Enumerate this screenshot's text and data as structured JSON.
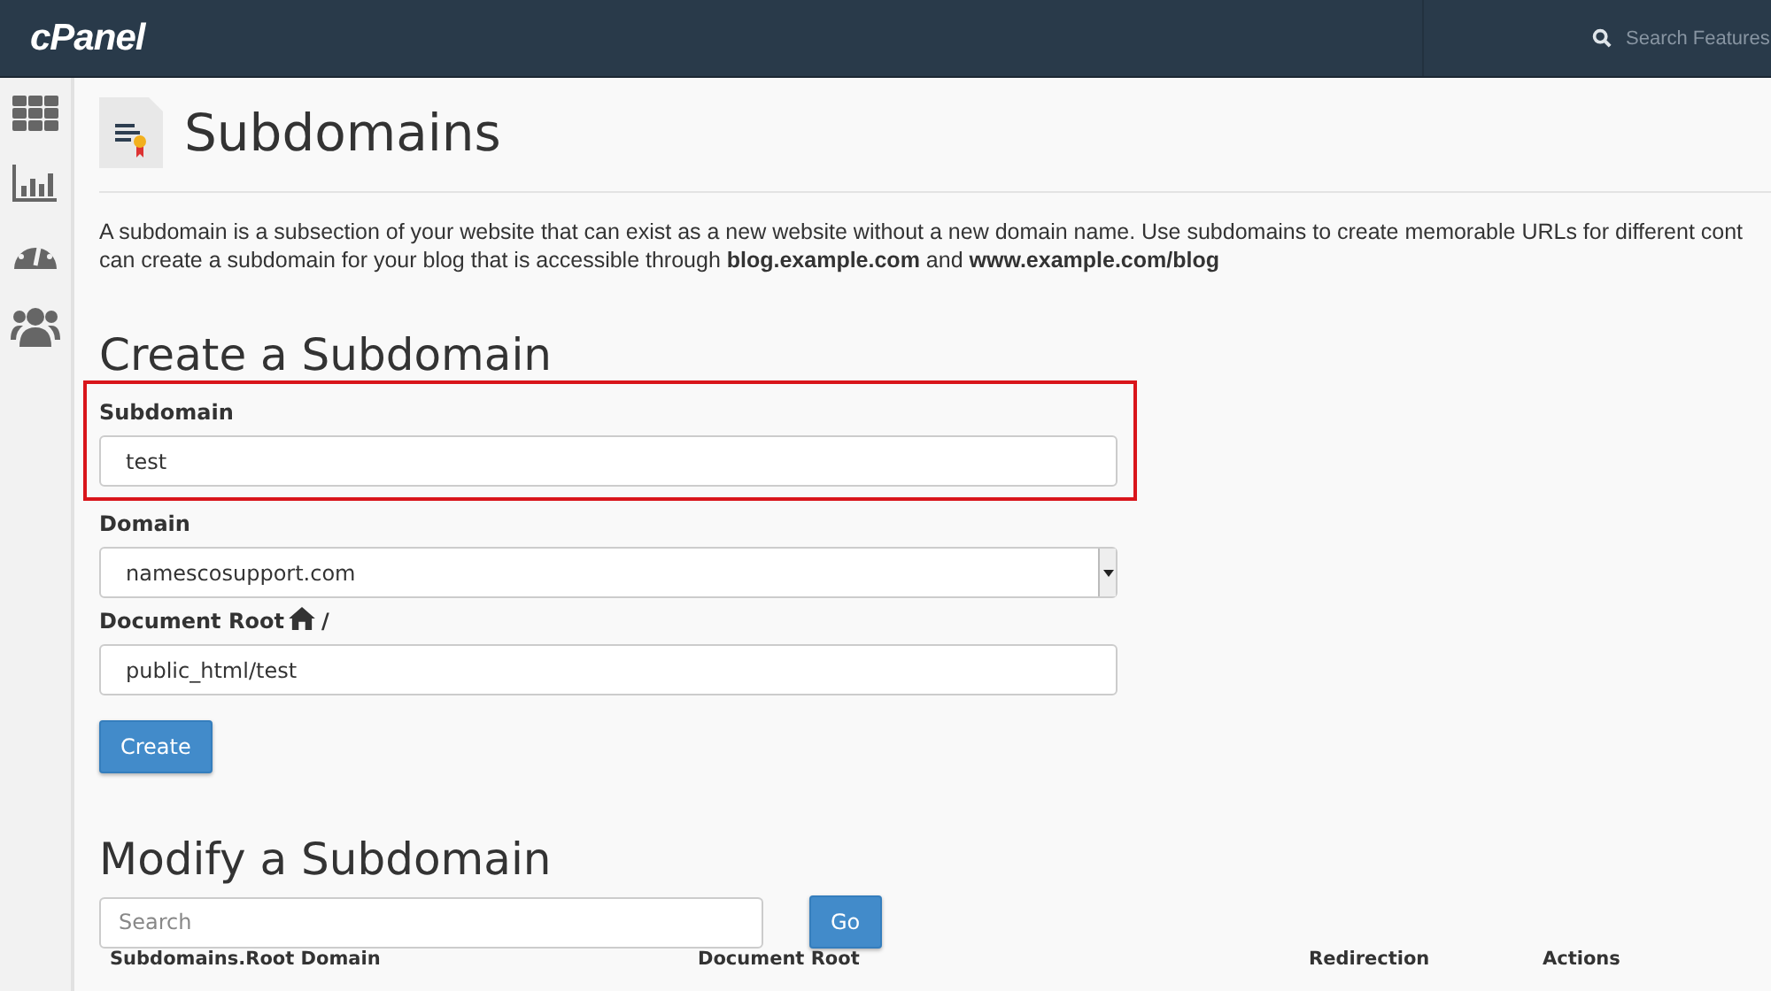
{
  "top_bar": {
    "logo": "cPanel",
    "search": {
      "placeholder": "Search Features"
    }
  },
  "sidebar": {
    "items": [
      {
        "kind": "grid"
      },
      {
        "kind": "chart"
      },
      {
        "kind": "gauge"
      },
      {
        "kind": "users"
      }
    ]
  },
  "page": {
    "title": "Subdomains",
    "description_lines": [
      "A subdomain is a subsection of your website that can exist as a new website without a new domain name. Use subdomains to create memorable URLs for different cont",
      "can create a subdomain for your blog that is accessible through **blog.example.com** and **www.example.com/blog**"
    ]
  },
  "create_form": {
    "heading": "Create a Subdomain",
    "fields": [
      {
        "kind": "text",
        "label": "Subdomain",
        "value": "test",
        "highlighted": true
      },
      {
        "kind": "select",
        "label": "Domain",
        "value": "namescosupport.com",
        "highlighted": false
      },
      {
        "kind": "docroot",
        "label": "Document Root",
        "suffix": "/",
        "value": "public_html/test",
        "highlighted": false
      }
    ],
    "button": "Create"
  },
  "modify": {
    "heading": "Modify a Subdomain",
    "search": {
      "placeholder": "Search"
    },
    "button": "Go",
    "table": {
      "columns": [
        "Subdomains.Root Domain",
        "Document Root",
        "Redirection",
        "Actions"
      ]
    }
  }
}
